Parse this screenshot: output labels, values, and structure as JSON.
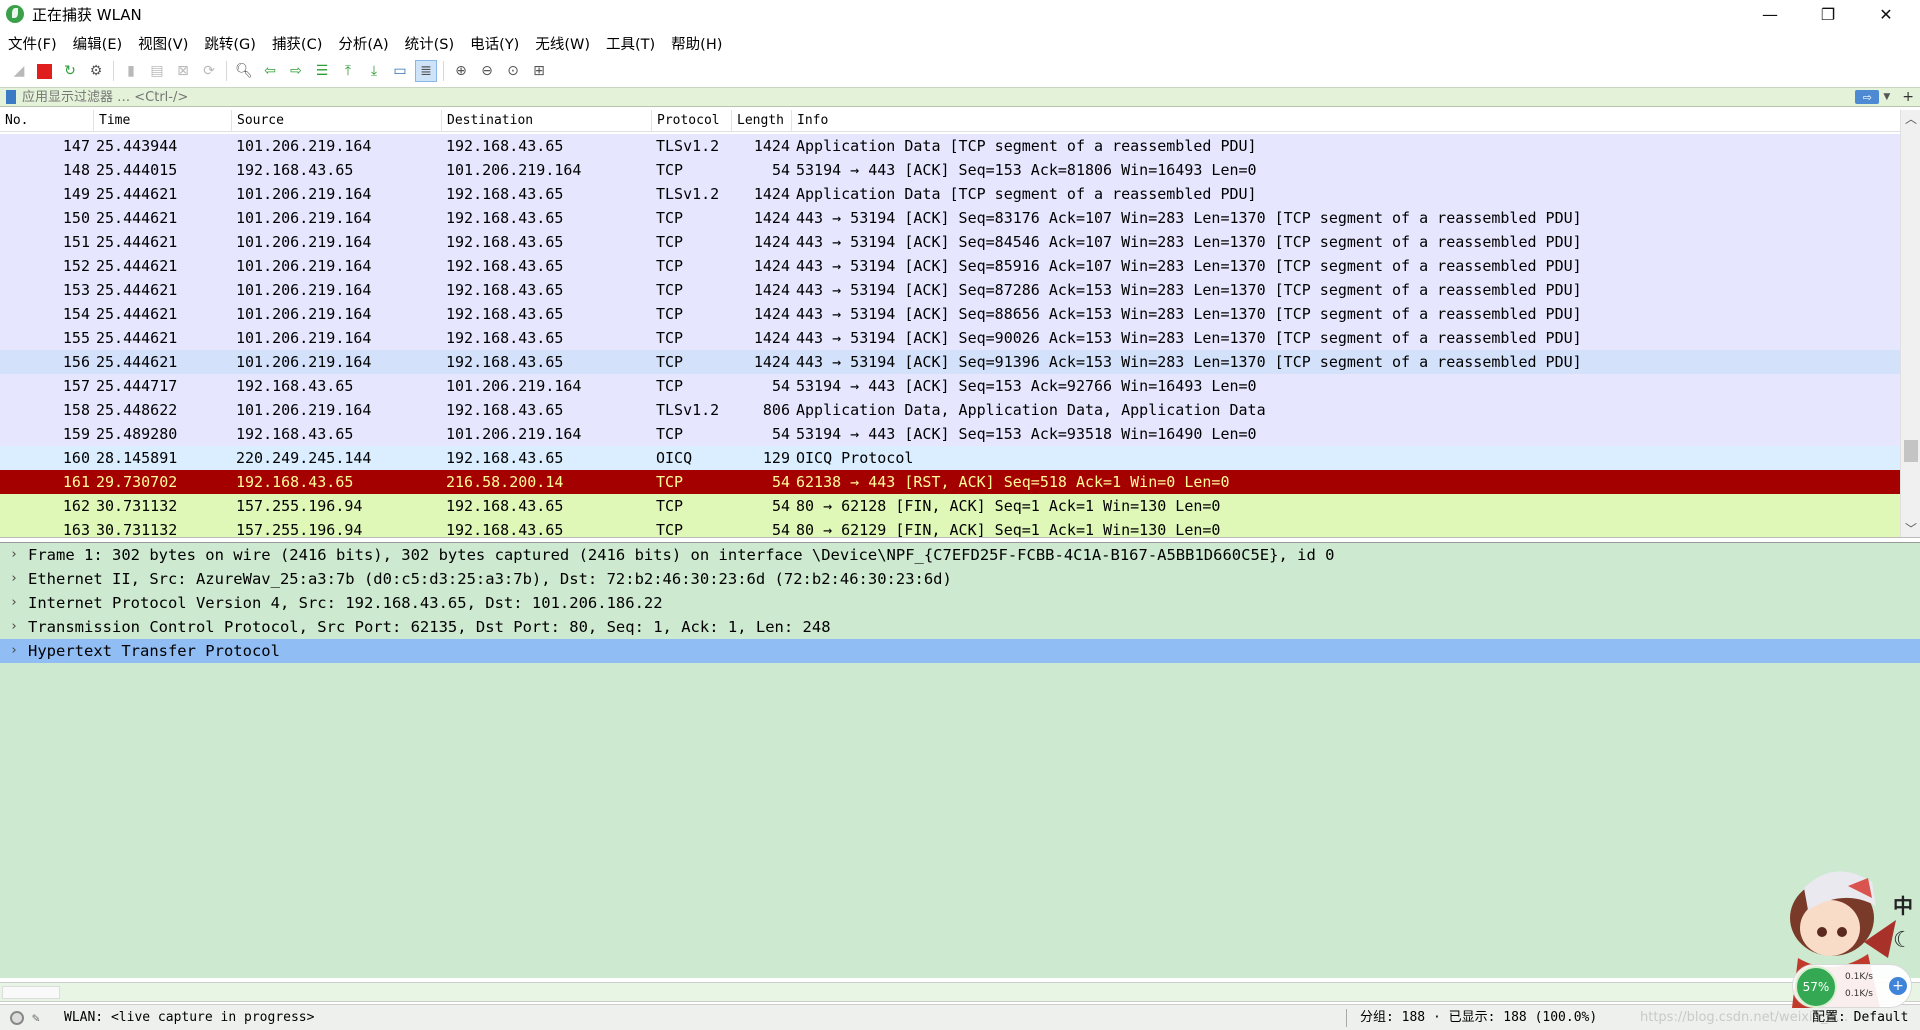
{
  "window": {
    "title": "正在捕获 WLAN",
    "minimize": "—",
    "restore": "❐",
    "close": "✕"
  },
  "menu": [
    "文件(F)",
    "编辑(E)",
    "视图(V)",
    "跳转(G)",
    "捕获(C)",
    "分析(A)",
    "统计(S)",
    "电话(Y)",
    "无线(W)",
    "工具(T)",
    "帮助(H)"
  ],
  "toolbar_icons": [
    "start-capture-icon",
    "stop-capture-icon",
    "restart-capture-icon",
    "capture-options-icon",
    "open-file-icon",
    "save-file-icon",
    "close-file-icon",
    "reload-file-icon",
    "find-packet-icon",
    "go-back-icon",
    "go-forward-icon",
    "go-to-packet-icon",
    "go-first-icon",
    "go-last-icon",
    "auto-scroll-icon",
    "colorize-icon",
    "zoom-in-icon",
    "zoom-out-icon",
    "zoom-normal-icon",
    "resize-columns-icon"
  ],
  "filter": {
    "placeholder": "应用显示过滤器 … <Ctrl-/>",
    "apply_symbol": "⇨"
  },
  "packet_list": {
    "columns": [
      "No.",
      "Time",
      "Source",
      "Destination",
      "Protocol",
      "Length",
      "Info"
    ],
    "rows": [
      {
        "no": "147",
        "time": "25.443944",
        "src": "101.206.219.164",
        "dst": "192.168.43.65",
        "proto": "TLSv1.2",
        "len": "1424",
        "info": "Application Data [TCP segment of a reassembled PDU]",
        "style": "tcp"
      },
      {
        "no": "148",
        "time": "25.444015",
        "src": "192.168.43.65",
        "dst": "101.206.219.164",
        "proto": "TCP",
        "len": "54",
        "info": "53194 → 443 [ACK] Seq=153 Ack=81806 Win=16493 Len=0",
        "style": "tcp"
      },
      {
        "no": "149",
        "time": "25.444621",
        "src": "101.206.219.164",
        "dst": "192.168.43.65",
        "proto": "TLSv1.2",
        "len": "1424",
        "info": "Application Data [TCP segment of a reassembled PDU]",
        "style": "tcp"
      },
      {
        "no": "150",
        "time": "25.444621",
        "src": "101.206.219.164",
        "dst": "192.168.43.65",
        "proto": "TCP",
        "len": "1424",
        "info": "443 → 53194 [ACK] Seq=83176 Ack=107 Win=283 Len=1370 [TCP segment of a reassembled PDU]",
        "style": "tcp"
      },
      {
        "no": "151",
        "time": "25.444621",
        "src": "101.206.219.164",
        "dst": "192.168.43.65",
        "proto": "TCP",
        "len": "1424",
        "info": "443 → 53194 [ACK] Seq=84546 Ack=107 Win=283 Len=1370 [TCP segment of a reassembled PDU]",
        "style": "tcp"
      },
      {
        "no": "152",
        "time": "25.444621",
        "src": "101.206.219.164",
        "dst": "192.168.43.65",
        "proto": "TCP",
        "len": "1424",
        "info": "443 → 53194 [ACK] Seq=85916 Ack=107 Win=283 Len=1370 [TCP segment of a reassembled PDU]",
        "style": "tcp"
      },
      {
        "no": "153",
        "time": "25.444621",
        "src": "101.206.219.164",
        "dst": "192.168.43.65",
        "proto": "TCP",
        "len": "1424",
        "info": "443 → 53194 [ACK] Seq=87286 Ack=153 Win=283 Len=1370 [TCP segment of a reassembled PDU]",
        "style": "tcp"
      },
      {
        "no": "154",
        "time": "25.444621",
        "src": "101.206.219.164",
        "dst": "192.168.43.65",
        "proto": "TCP",
        "len": "1424",
        "info": "443 → 53194 [ACK] Seq=88656 Ack=153 Win=283 Len=1370 [TCP segment of a reassembled PDU]",
        "style": "tcp"
      },
      {
        "no": "155",
        "time": "25.444621",
        "src": "101.206.219.164",
        "dst": "192.168.43.65",
        "proto": "TCP",
        "len": "1424",
        "info": "443 → 53194 [ACK] Seq=90026 Ack=153 Win=283 Len=1370 [TCP segment of a reassembled PDU]",
        "style": "tcp"
      },
      {
        "no": "156",
        "time": "25.444621",
        "src": "101.206.219.164",
        "dst": "192.168.43.65",
        "proto": "TCP",
        "len": "1424",
        "info": "443 → 53194 [ACK] Seq=91396 Ack=153 Win=283 Len=1370 [TCP segment of a reassembled PDU]",
        "style": "tcp-hover"
      },
      {
        "no": "157",
        "time": "25.444717",
        "src": "192.168.43.65",
        "dst": "101.206.219.164",
        "proto": "TCP",
        "len": "54",
        "info": "53194 → 443 [ACK] Seq=153 Ack=92766 Win=16493 Len=0",
        "style": "tcp"
      },
      {
        "no": "158",
        "time": "25.448622",
        "src": "101.206.219.164",
        "dst": "192.168.43.65",
        "proto": "TLSv1.2",
        "len": "806",
        "info": "Application Data, Application Data, Application Data",
        "style": "tcp"
      },
      {
        "no": "159",
        "time": "25.489280",
        "src": "192.168.43.65",
        "dst": "101.206.219.164",
        "proto": "TCP",
        "len": "54",
        "info": "53194 → 443 [ACK] Seq=153 Ack=93518 Win=16490 Len=0",
        "style": "tcp"
      },
      {
        "no": "160",
        "time": "28.145891",
        "src": "220.249.245.144",
        "dst": "192.168.43.65",
        "proto": "OICQ",
        "len": "129",
        "info": "OICQ Protocol",
        "style": "udp"
      },
      {
        "no": "161",
        "time": "29.730702",
        "src": "192.168.43.65",
        "dst": "216.58.200.14",
        "proto": "TCP",
        "len": "54",
        "info": "62138 → 443 [RST, ACK] Seq=518 Ack=1 Win=0 Len=0",
        "style": "rst"
      },
      {
        "no": "162",
        "time": "30.731132",
        "src": "157.255.196.94",
        "dst": "192.168.43.65",
        "proto": "TCP",
        "len": "54",
        "info": "80 → 62128 [FIN, ACK] Seq=1 Ack=1 Win=130 Len=0",
        "style": "fin"
      },
      {
        "no": "163",
        "time": "30.731132",
        "src": "157.255.196.94",
        "dst": "192.168.43.65",
        "proto": "TCP",
        "len": "54",
        "info": "80 → 62129 [FIN, ACK] Seq=1 Ack=1 Win=130 Len=0",
        "style": "fin"
      }
    ]
  },
  "row_colors": {
    "tcp": "#e7e6ff",
    "tcp-hover": "#d4e1fb",
    "udp": "#daeeff",
    "rst": "#a40000",
    "rst_text": "#fffc9c",
    "fin": "#dff8b8"
  },
  "details": [
    {
      "text": "Frame 1: 302 bytes on wire (2416 bits), 302 bytes captured (2416 bits) on interface \\Device\\NPF_{C7EFD25F-FCBB-4C1A-B167-A5BB1D660C5E}, id 0",
      "selected": false
    },
    {
      "text": "Ethernet II, Src: AzureWav_25:a3:7b (d0:c5:d3:25:a3:7b), Dst: 72:b2:46:30:23:6d (72:b2:46:30:23:6d)",
      "selected": false
    },
    {
      "text": "Internet Protocol Version 4, Src: 192.168.43.65, Dst: 101.206.186.22",
      "selected": false
    },
    {
      "text": "Transmission Control Protocol, Src Port: 62135, Dst Port: 80, Seq: 1, Ack: 1, Len: 248",
      "selected": false
    },
    {
      "text": "Hypertext Transfer Protocol",
      "selected": true
    }
  ],
  "status": {
    "capture": "WLAN: <live capture in progress>",
    "packets": "分组: 188 · 已显示: 188 (100.0%)",
    "profile": "配置: Default",
    "watermark": "https://blog.csdn.net/weixin_4..."
  },
  "widget": {
    "cpu": "57%",
    "up": "0.1K/s",
    "down": "0.1K/s",
    "ime": "中",
    "moon": "☾"
  }
}
